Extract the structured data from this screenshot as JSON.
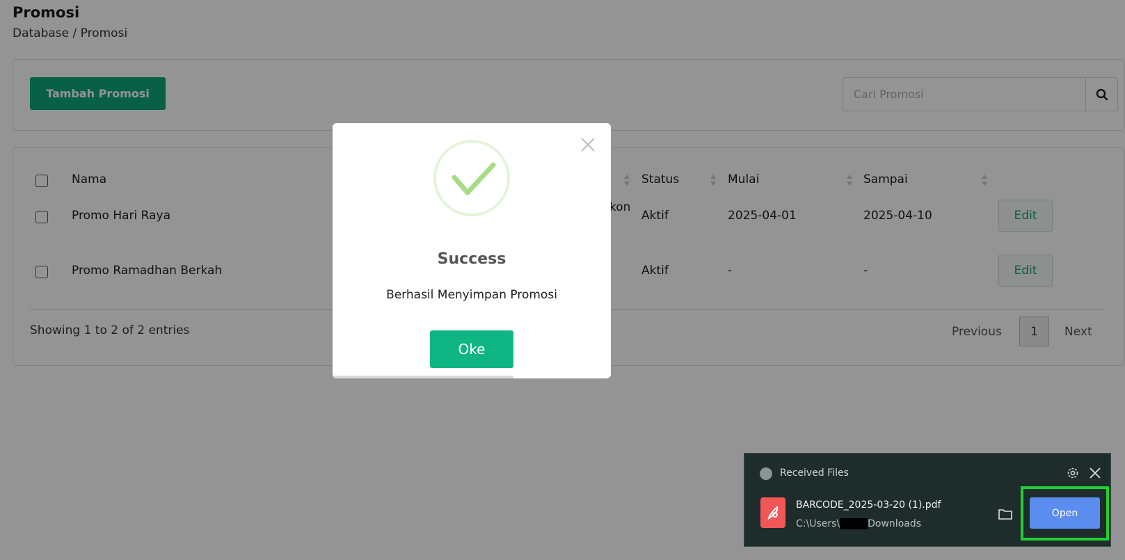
{
  "page": {
    "title": "Promosi",
    "breadcrumb": "Database / Promosi"
  },
  "toolbar": {
    "add_label": "Tambah Promosi",
    "search_placeholder": "Cari Promosi",
    "search_icon": "search-icon"
  },
  "table": {
    "headers": {
      "name": "Nama",
      "partial": "",
      "status": "Status",
      "start": "Mulai",
      "end": "Sampai"
    },
    "rows": [
      {
        "name": "Promo Hari Raya",
        "partial": "kon",
        "status": "Aktif",
        "start": "2025-04-01",
        "end": "2025-04-10",
        "action": "Edit"
      },
      {
        "name": "Promo Ramadhan Berkah",
        "partial": "",
        "status": "Aktif",
        "start": "-",
        "end": "-",
        "action": "Edit"
      }
    ],
    "footer": {
      "entries": "Showing 1 to 2 of 2 entries",
      "previous": "Previous",
      "page": "1",
      "next": "Next"
    }
  },
  "modal": {
    "title": "Success",
    "message": "Berhasil Menyimpan Promosi",
    "ok_label": "Oke",
    "icon": "success-check-icon"
  },
  "toast": {
    "title": "Received Files",
    "file_name": "BARCODE_2025-03-20 (1).pdf",
    "path_prefix": "C:\\Users\\",
    "path_suffix": "Downloads",
    "open_label": "Open"
  },
  "colors": {
    "brand_green": "#0fa57a",
    "ok_green": "#0fb683",
    "check_green": "#a5dc86",
    "open_blue": "#5b8def",
    "highlight": "#1fd12f",
    "toast_bg": "#1e2d2b"
  }
}
